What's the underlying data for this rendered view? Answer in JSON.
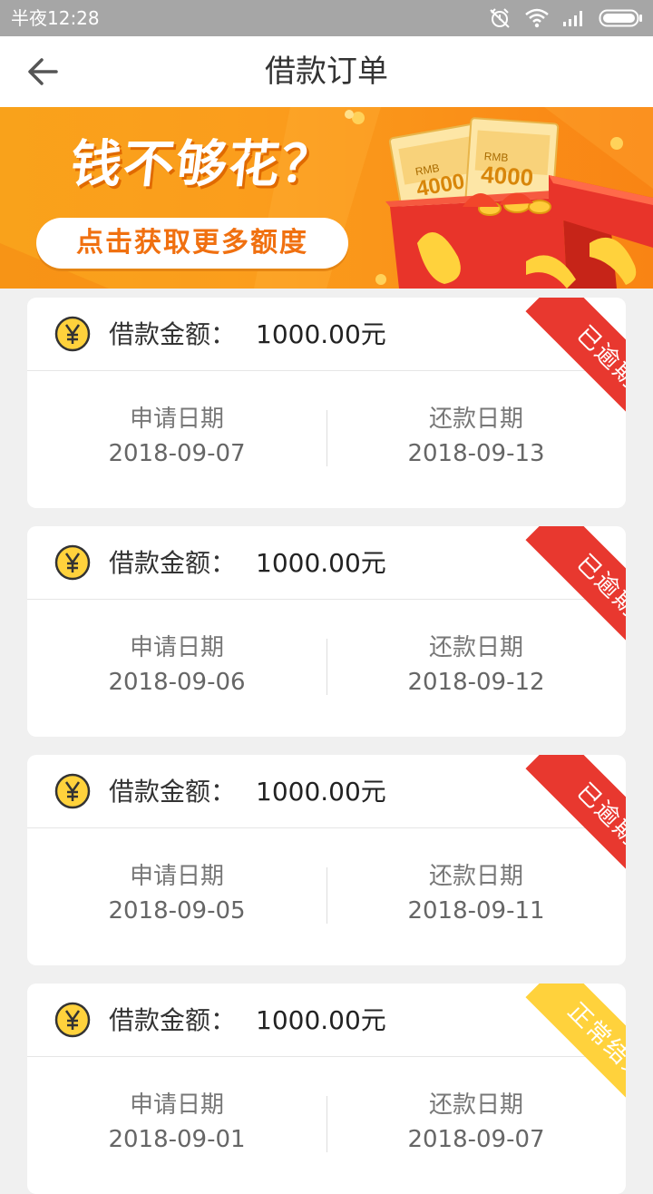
{
  "status_bar": {
    "time": "半夜12:28"
  },
  "header": {
    "title": "借款订单"
  },
  "banner": {
    "headline": "钱不够花？",
    "cta": "点击获取更多额度",
    "ticket_currency": "RMB",
    "ticket_amount": "4000"
  },
  "orders": [
    {
      "amount_label": "借款金额：",
      "amount": "1000.00元",
      "apply_label": "申请日期",
      "apply_date": "2018-09-07",
      "repay_label": "还款日期",
      "repay_date": "2018-09-13",
      "status": "已逾期",
      "status_color": "#e8382f"
    },
    {
      "amount_label": "借款金额：",
      "amount": "1000.00元",
      "apply_label": "申请日期",
      "apply_date": "2018-09-06",
      "repay_label": "还款日期",
      "repay_date": "2018-09-12",
      "status": "已逾期",
      "status_color": "#e8382f"
    },
    {
      "amount_label": "借款金额：",
      "amount": "1000.00元",
      "apply_label": "申请日期",
      "apply_date": "2018-09-05",
      "repay_label": "还款日期",
      "repay_date": "2018-09-11",
      "status": "已逾期",
      "status_color": "#e8382f"
    },
    {
      "amount_label": "借款金额：",
      "amount": "1000.00元",
      "apply_label": "申请日期",
      "apply_date": "2018-09-01",
      "repay_label": "还款日期",
      "repay_date": "2018-09-07",
      "status": "正常结束",
      "status_color": "#ffd23c"
    }
  ],
  "icons": {
    "back": "arrow-left-icon",
    "amount": "yen-coin-icon",
    "status_bar": [
      "alarm-off-icon",
      "wifi-icon",
      "signal-icon",
      "battery-icon"
    ]
  }
}
